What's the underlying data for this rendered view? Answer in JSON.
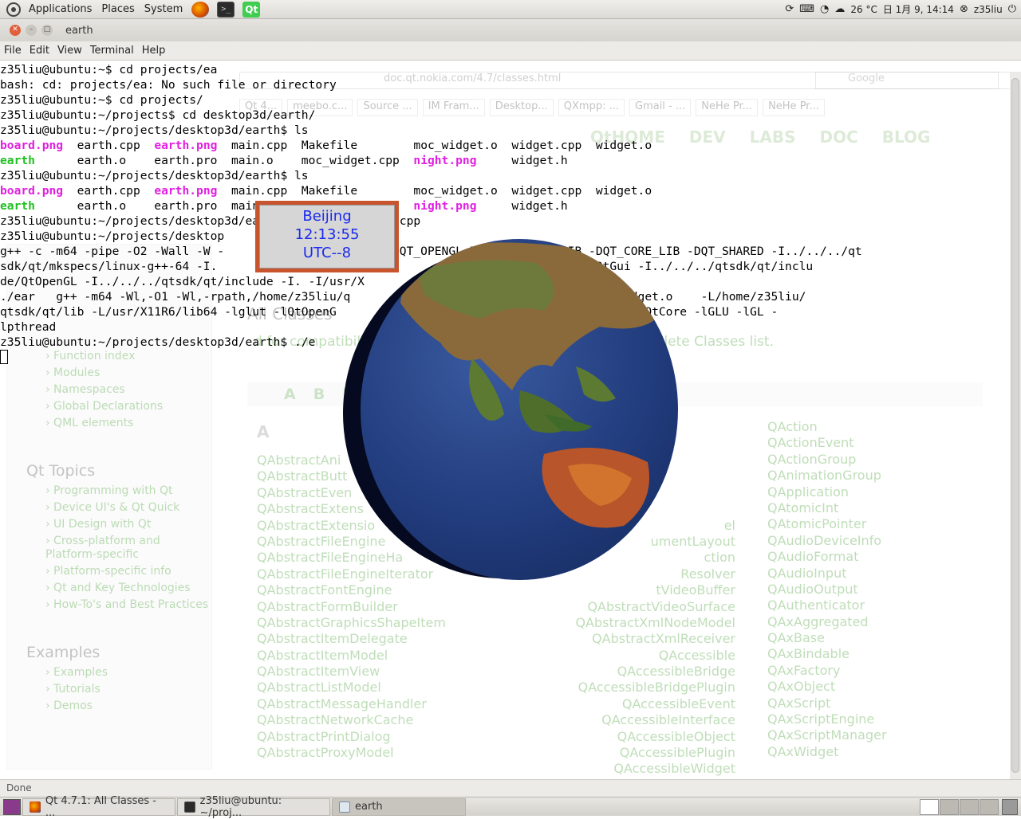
{
  "top_panel": {
    "menus": [
      "Applications",
      "Places",
      "System"
    ],
    "tray": {
      "weather": "26 °C",
      "clock": "日 1月 9, 14:14",
      "user": "z35liu"
    }
  },
  "window": {
    "title": "earth",
    "menu": [
      "File",
      "Edit",
      "View",
      "Terminal",
      "Help"
    ]
  },
  "terminal": {
    "lines": [
      {
        "segs": [
          {
            "t": "z35liu@ubuntu:~$ cd projects/ea",
            "c": ""
          }
        ]
      },
      {
        "segs": [
          {
            "t": "bash: cd: projects/ea: No such file or directory",
            "c": ""
          }
        ]
      },
      {
        "segs": [
          {
            "t": "z35liu@ubuntu:~$ cd projects/",
            "c": ""
          }
        ]
      },
      {
        "segs": [
          {
            "t": "z35liu@ubuntu:~/projects$ cd desktop3d/earth/",
            "c": ""
          }
        ]
      },
      {
        "segs": [
          {
            "t": "z35liu@ubuntu:~/projects/desktop3d/earth$ ls",
            "c": ""
          }
        ]
      },
      {
        "segs": [
          {
            "t": "board.png",
            "c": "pk"
          },
          {
            "t": "  earth.cpp  ",
            "c": ""
          },
          {
            "t": "earth.png",
            "c": "pk"
          },
          {
            "t": "  main.cpp  Makefile        moc_widget.o  widget.cpp  widget.o",
            "c": ""
          }
        ]
      },
      {
        "segs": [
          {
            "t": "earth",
            "c": "gr"
          },
          {
            "t": "      earth.o    earth.pro  main.o    moc_widget.cpp  ",
            "c": ""
          },
          {
            "t": "night.png",
            "c": "pk"
          },
          {
            "t": "     widget.h",
            "c": ""
          }
        ]
      },
      {
        "segs": [
          {
            "t": "z35liu@ubuntu:~/projects/desktop3d/earth$ ls",
            "c": ""
          }
        ]
      },
      {
        "segs": [
          {
            "t": "board.png",
            "c": "pk"
          },
          {
            "t": "  earth.cpp  ",
            "c": ""
          },
          {
            "t": "earth.png",
            "c": "pk"
          },
          {
            "t": "  main.cpp  Makefile        moc_widget.o  widget.cpp  widget.o",
            "c": ""
          }
        ]
      },
      {
        "segs": [
          {
            "t": "earth",
            "c": "gr"
          },
          {
            "t": "      earth.o    earth.pro  main.o    moc_widget.cpp  ",
            "c": ""
          },
          {
            "t": "night.png",
            "c": "pk"
          },
          {
            "t": "     widget.h",
            "c": ""
          }
        ]
      },
      {
        "segs": [
          {
            "t": "z35liu@ubuntu:~/projects/desktop3d/earth$               .cpp",
            "c": ""
          }
        ]
      },
      {
        "segs": [
          {
            "t": "z35liu@ubuntu:~/projects/desktop",
            "c": ""
          }
        ]
      },
      {
        "segs": [
          {
            "t": "g++ -c -m64 -pipe -O2 -Wall -W -               O_DEBUG -DQT_OPENGL_LIB -DQT_GUI_LIB -DQT_CORE_LIB -DQT_SHARED -I../../../qt",
            "c": ""
          }
        ]
      },
      {
        "segs": [
          {
            "t": "sdk/qt/mkspecs/linux-g++-64 -I.               t/incl           ./../qtsdk/qt/include/QtGui -I../../../qtsdk/qt/inclu",
            "c": ""
          }
        ]
      },
      {
        "segs": [
          {
            "t": "de/QtOpenGL -I../../../qtsdk/qt/include -I. -I/usr/X                  th.o earth.cpp",
            "c": ""
          }
        ]
      },
      {
        "segs": [
          {
            "t": "./ear   g++ -m64 -Wl,-O1 -Wl,-rpath,/home/z35liu/q                 widget.o earth.o moc_widget.o    -L/home/z35liu/",
            "c": ""
          }
        ]
      },
      {
        "segs": [
          {
            "t": "qtsdk/qt/lib -L/usr/X11R6/lib64 -lglut -lQtOpenG                 /usr/X11R6/lib64 -lQtGui -lQtCore -lGLU -lGL -",
            "c": ""
          }
        ]
      },
      {
        "segs": [
          {
            "t": "lpthread",
            "c": ""
          }
        ]
      },
      {
        "segs": [
          {
            "t": "z35liu@ubuntu:~/projects/desktop3d/earth$ ./e",
            "c": ""
          }
        ]
      }
    ]
  },
  "clock_widget": {
    "city": "Beijing",
    "time": "12:13:55",
    "utc": "UTC--8"
  },
  "browser_ghost": {
    "url": "doc.qt.nokia.com/4.7/classes.html",
    "search": "Google",
    "tabs": [
      "Qt 4...",
      "meebo.c...",
      "Source ...",
      "IM Fram...",
      "Desktop...",
      "QXmpp: ...",
      "Gmail - ...",
      "NeHe Pr...",
      "NeHe Pr..."
    ],
    "nav": [
      "QtHOME",
      "DEV",
      "LABS",
      "DOC",
      "BLOG"
    ],
    "heading": "All Classes",
    "intro": "d for compatibility with Qt3, see Qt3 Support Classes. For cl           lete Classes list.",
    "alphabet": [
      "A",
      "B",
      "P",
      "Q",
      "R",
      "S",
      "T",
      "U",
      "V",
      "W",
      "X"
    ],
    "sidebar": {
      "lookup_items": [
        "Function index",
        "Modules",
        "Namespaces",
        "Global Declarations",
        "QML elements"
      ],
      "topics_title": "Qt Topics",
      "topics": [
        "Programming with Qt",
        "Device UI's & Qt Quick",
        "UI Design with Qt",
        "Cross-platform and Platform-specific",
        "Platform-specific info",
        "Qt and Key Technologies",
        "How-To's and Best Practices"
      ],
      "examples_title": "Examples",
      "examples": [
        "Examples",
        "Tutorials",
        "Demos"
      ]
    },
    "col1": [
      "QAbstractAni",
      "QAbstractButt",
      "QAbstractEven",
      "QAbstractExtens",
      "QAbstractExtensio",
      "QAbstractFileEngine",
      "QAbstractFileEngineHa",
      "QAbstractFileEngineIterator",
      "QAbstractFontEngine",
      "QAbstractFormBuilder",
      "QAbstractGraphicsShapeItem",
      "QAbstractItemDelegate",
      "QAbstractItemModel",
      "QAbstractItemView",
      "QAbstractListModel",
      "QAbstractMessageHandler",
      "QAbstractNetworkCache",
      "QAbstractPrintDialog",
      "QAbstractProxyModel"
    ],
    "col2": [
      "",
      "",
      "",
      "",
      "el",
      "umentLayout",
      "ction",
      "Resolver",
      "tVideoBuffer",
      "QAbstractVideoSurface",
      "QAbstractXmlNodeModel",
      "QAbstractXmlReceiver",
      "QAccessible",
      "QAccessibleBridge",
      "QAccessibleBridgePlugin",
      "QAccessibleEvent",
      "QAccessibleInterface",
      "QAccessibleObject",
      "QAccessiblePlugin",
      "QAccessibleWidget"
    ],
    "col3": [
      "QAction",
      "QActionEvent",
      "QActionGroup",
      "QAnimationGroup",
      "QApplication",
      "QAtomicInt",
      "QAtomicPointer",
      "QAudioDeviceInfo",
      "QAudioFormat",
      "QAudioInput",
      "QAudioOutput",
      "QAuthenticator",
      "QAxAggregated",
      "QAxBase",
      "QAxBindable",
      "QAxFactory",
      "QAxObject",
      "QAxScript",
      "QAxScriptEngine",
      "QAxScriptManager",
      "QAxWidget"
    ]
  },
  "status": "Done",
  "taskbar": {
    "items": [
      "Qt 4.7.1: All Classes - ...",
      "z35liu@ubuntu: ~/proj...",
      "earth"
    ]
  }
}
